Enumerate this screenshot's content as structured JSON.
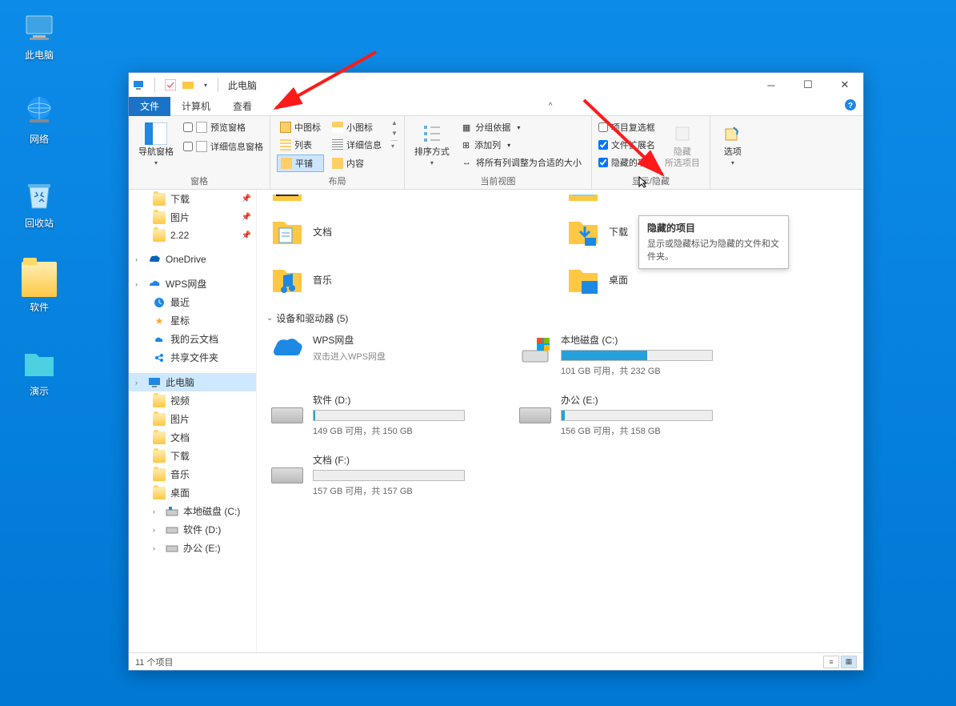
{
  "desktop_icons": [
    {
      "label": "此电脑",
      "type": "pc"
    },
    {
      "label": "网络",
      "type": "network"
    },
    {
      "label": "回收站",
      "type": "recycle"
    },
    {
      "label": "软件",
      "type": "folder"
    },
    {
      "label": "演示",
      "type": "folder_cyan"
    }
  ],
  "window": {
    "title": "此电脑",
    "tabs": [
      {
        "label": "文件",
        "active": true
      },
      {
        "label": "计算机",
        "active": false
      },
      {
        "label": "查看",
        "active": false
      }
    ],
    "ribbon": {
      "g1": {
        "nav": "导航窗格",
        "preview": "预览窗格",
        "details": "详细信息窗格",
        "label": "窗格"
      },
      "g2": {
        "medium": "中图标",
        "small": "小图标",
        "list": "列表",
        "detail": "详细信息",
        "tile": "平铺",
        "content": "内容",
        "label": "布局"
      },
      "g3": {
        "sort": "排序方式",
        "group": "分组依据",
        "addcol": "添加列",
        "fit": "将所有列调整为合适的大小",
        "label": "当前视图"
      },
      "g4": {
        "checkboxes": "项目复选框",
        "extensions": "文件扩展名",
        "hidden": "隐藏的项目",
        "hide": "隐藏",
        "hide2": "所选项目",
        "label": "显示/隐藏"
      },
      "g5": {
        "options": "选项"
      }
    },
    "tooltip": {
      "title": "隐藏的项目",
      "desc": "显示或隐藏标记为隐藏的文件和文件夹。"
    },
    "nav": [
      {
        "label": "下载",
        "icon": "folder",
        "pin": true,
        "indent": 1
      },
      {
        "label": "图片",
        "icon": "folder",
        "pin": true,
        "indent": 1
      },
      {
        "label": "2.22",
        "icon": "folder",
        "pin": true,
        "indent": 1
      },
      {
        "label": "OneDrive",
        "icon": "onedrive",
        "indent": 0,
        "expand": true
      },
      {
        "label": "WPS网盘",
        "icon": "wps",
        "indent": 0,
        "expand": true
      },
      {
        "label": "最近",
        "icon": "recent",
        "indent": 1
      },
      {
        "label": "星标",
        "icon": "star",
        "indent": 1
      },
      {
        "label": "我的云文档",
        "icon": "cloud",
        "indent": 1
      },
      {
        "label": "共享文件夹",
        "icon": "share",
        "indent": 1
      },
      {
        "label": "此电脑",
        "icon": "pc",
        "indent": 0,
        "selected": true,
        "expand": true
      },
      {
        "label": "视频",
        "icon": "folder",
        "indent": 1
      },
      {
        "label": "图片",
        "icon": "folder",
        "indent": 1
      },
      {
        "label": "文档",
        "icon": "folder",
        "indent": 1
      },
      {
        "label": "下载",
        "icon": "folder",
        "indent": 1
      },
      {
        "label": "音乐",
        "icon": "folder",
        "indent": 1
      },
      {
        "label": "桌面",
        "icon": "folder",
        "indent": 1
      },
      {
        "label": "本地磁盘 (C:)",
        "icon": "drive",
        "indent": 1,
        "expand": true
      },
      {
        "label": "软件 (D:)",
        "icon": "drive",
        "indent": 1,
        "expand": true
      },
      {
        "label": "办公 (E:)",
        "icon": "drive",
        "indent": 1,
        "expand": true
      }
    ],
    "content": {
      "folders": [
        [
          {
            "label": "文档",
            "type": "docs"
          },
          {
            "label": "下载",
            "type": "download"
          }
        ],
        [
          {
            "label": "音乐",
            "type": "music"
          },
          {
            "label": "桌面",
            "type": "desktop"
          }
        ]
      ],
      "section_label": "设备和驱动器 (5)",
      "drives": [
        [
          {
            "name": "WPS网盘",
            "sublabel": "双击进入WPS网盘",
            "type": "wps"
          },
          {
            "name": "本地磁盘 (C:)",
            "usage": "101 GB 可用，共 232 GB",
            "fill": 57,
            "color": "#26a0da",
            "type": "drive_os"
          }
        ],
        [
          {
            "name": "软件 (D:)",
            "usage": "149 GB 可用，共 150 GB",
            "fill": 1,
            "type": "drive"
          },
          {
            "name": "办公 (E:)",
            "usage": "156 GB 可用，共 158 GB",
            "fill": 2,
            "type": "drive"
          }
        ],
        [
          {
            "name": "文档 (F:)",
            "usage": "157 GB 可用，共 157 GB",
            "fill": 0,
            "type": "drive"
          }
        ]
      ]
    },
    "status": "11 个项目"
  }
}
